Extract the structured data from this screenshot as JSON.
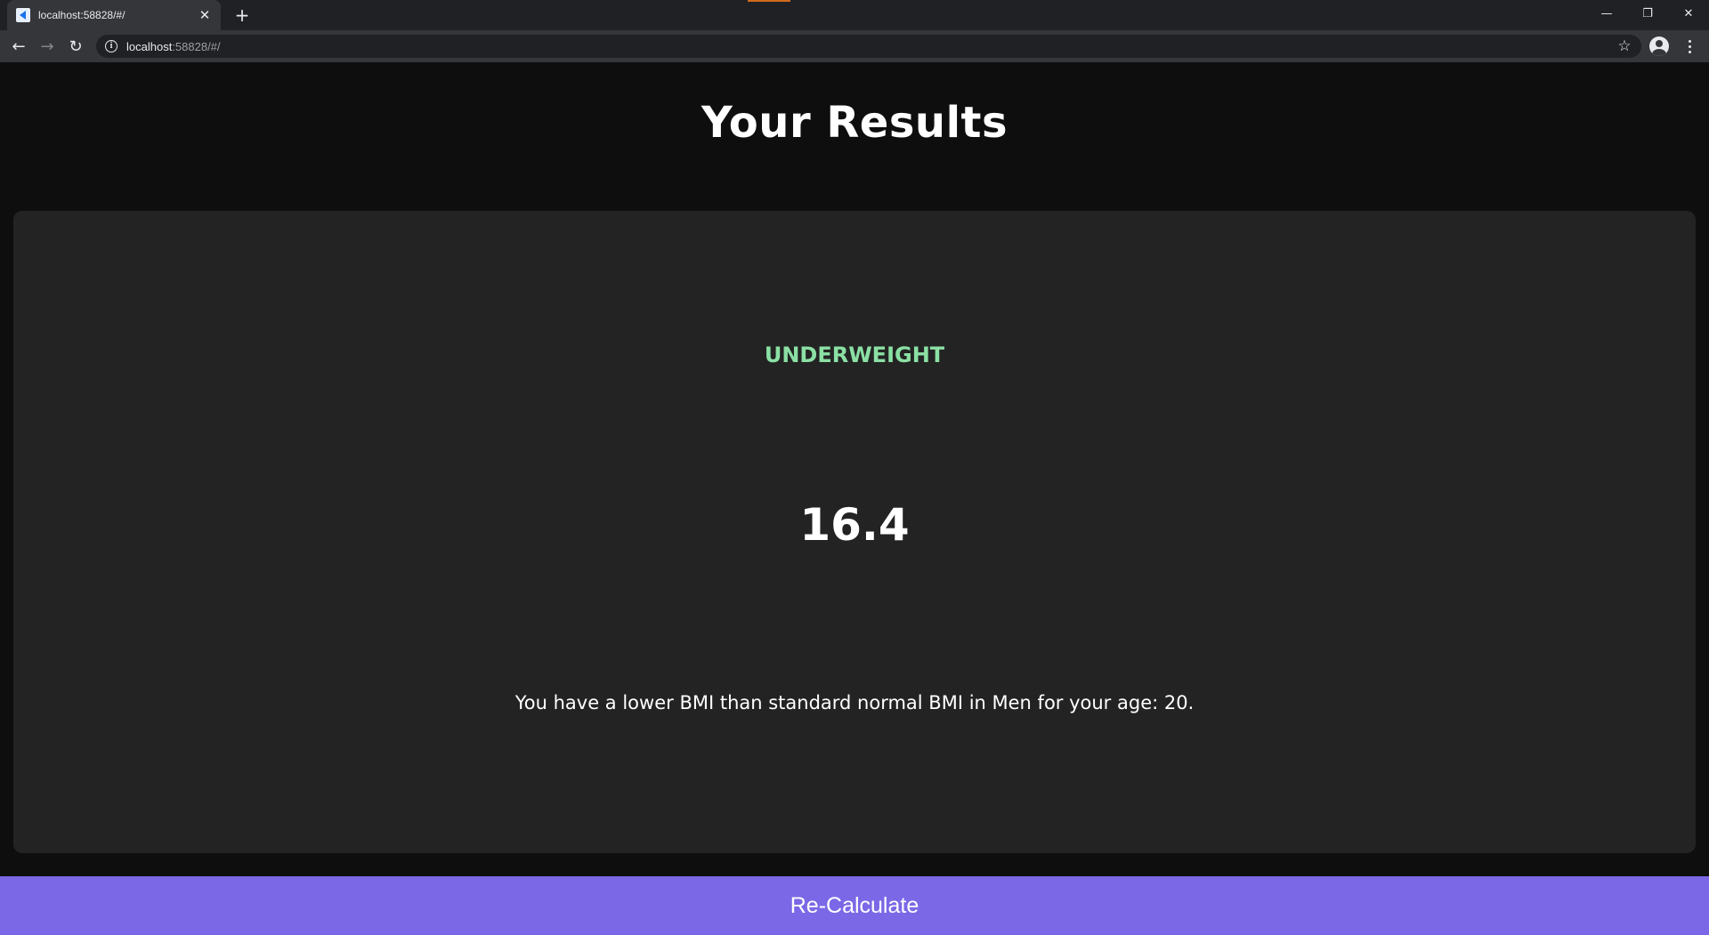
{
  "browser": {
    "tab": {
      "title": "localhost:58828/#/",
      "close_glyph": "✕",
      "favicon": "flutter-icon"
    },
    "new_tab_glyph": "+",
    "window_controls": {
      "minimize": "—",
      "restore": "❐",
      "close": "✕"
    },
    "nav": {
      "back": "←",
      "forward": "→",
      "reload": "↻"
    },
    "address": {
      "host": "localhost",
      "rest": ":58828/#/"
    },
    "bookmark_glyph": "☆"
  },
  "app": {
    "title": "Your Results",
    "result": {
      "status": "UNDERWEIGHT",
      "bmi": "16.4",
      "message": "You have a lower BMI than standard normal BMI in Men for your age: 20."
    },
    "recalc_label": "Re-Calculate"
  },
  "colors": {
    "background": "#0e0e0e",
    "card": "#232323",
    "status": "#8be0a4",
    "button": "#7b68e6"
  }
}
